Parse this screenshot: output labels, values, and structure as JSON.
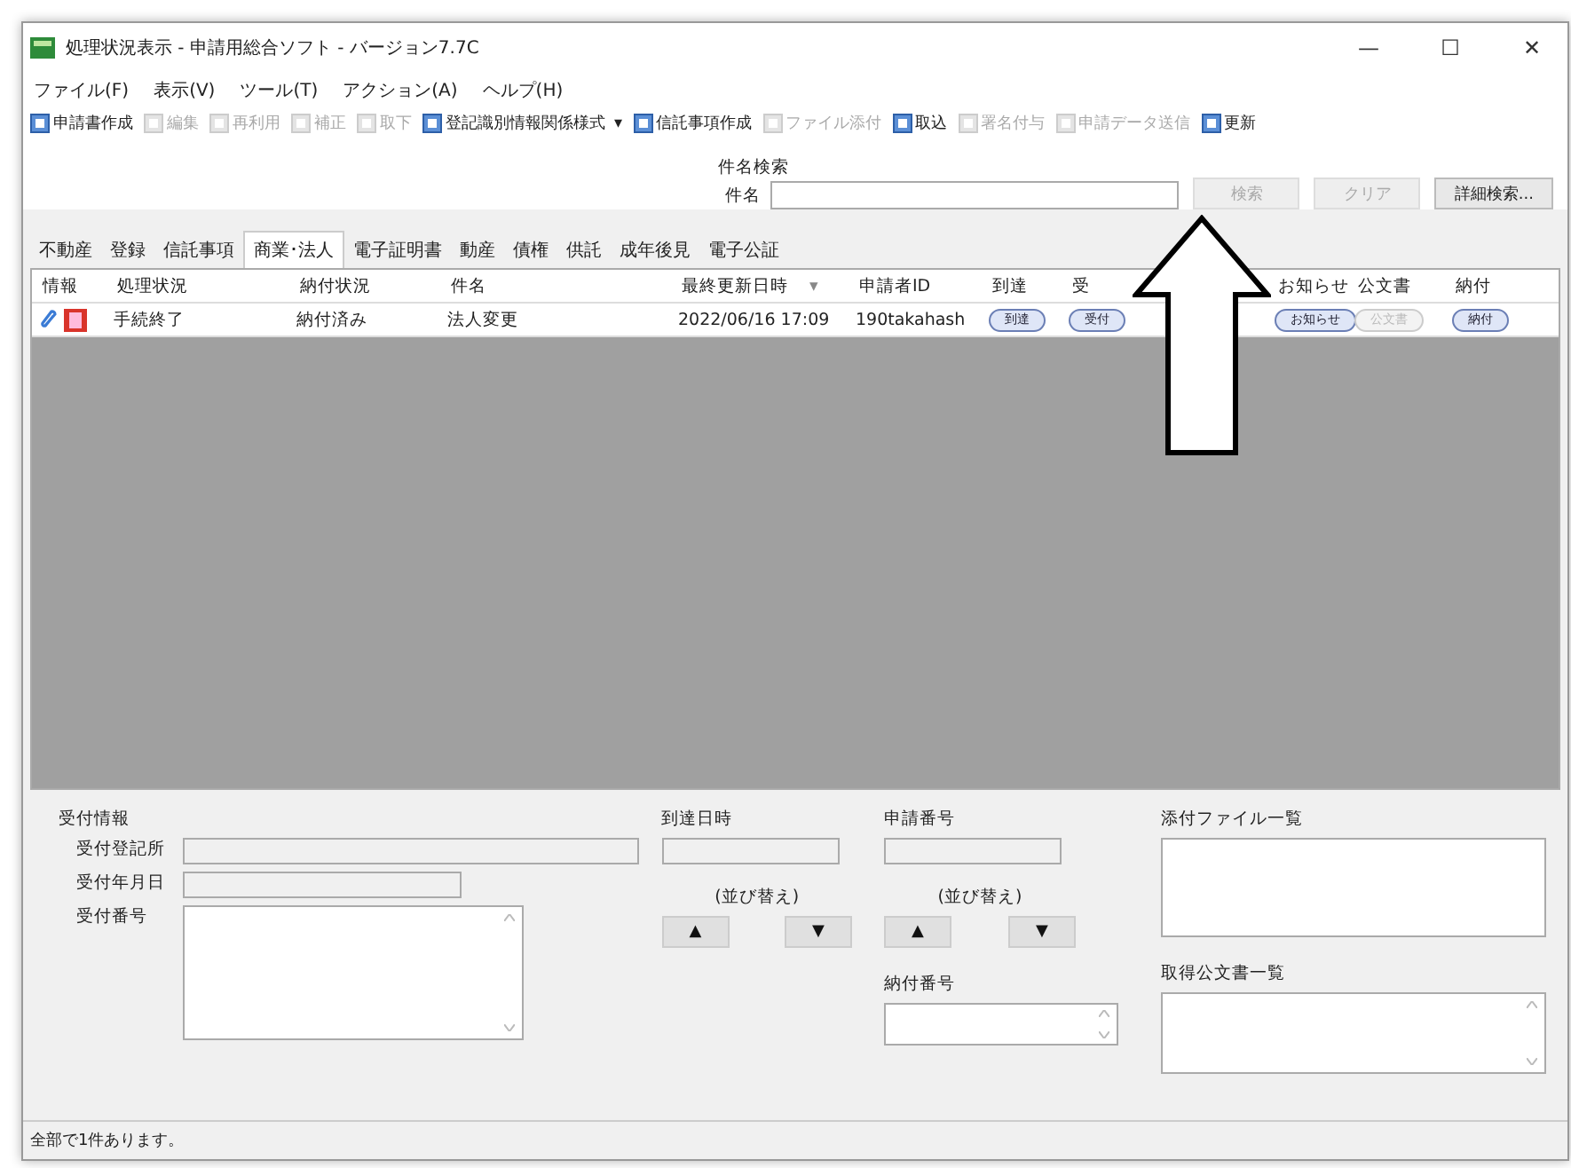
{
  "window": {
    "title": "処理状況表示 - 申請用総合ソフト - バージョン7.7C"
  },
  "menu": [
    "ファイル(F)",
    "表示(V)",
    "ツール(T)",
    "アクション(A)",
    "ヘルプ(H)"
  ],
  "toolbar": [
    {
      "label": "申請書作成",
      "disabled": false
    },
    {
      "label": "編集",
      "disabled": true
    },
    {
      "label": "再利用",
      "disabled": true
    },
    {
      "label": "補正",
      "disabled": true
    },
    {
      "label": "取下",
      "disabled": true
    },
    {
      "label": "登記識別情報関係様式",
      "disabled": false,
      "caret": "▾"
    },
    {
      "label": "信託事項作成",
      "disabled": false
    },
    {
      "label": "ファイル添付",
      "disabled": true
    },
    {
      "label": "取込",
      "disabled": false
    },
    {
      "label": "署名付与",
      "disabled": true
    },
    {
      "label": "申請データ送信",
      "disabled": true
    },
    {
      "label": "更新",
      "disabled": false
    }
  ],
  "search": {
    "group": "件名検索",
    "label": "件名",
    "buttons": [
      {
        "label": "検索",
        "disabled": true
      },
      {
        "label": "クリア",
        "disabled": true
      },
      {
        "label": "詳細検索...",
        "disabled": false
      }
    ]
  },
  "tabs": [
    {
      "label": "不動産",
      "selected": false
    },
    {
      "label": "登録",
      "selected": false
    },
    {
      "label": "信託事項",
      "selected": false
    },
    {
      "label": "商業･法人",
      "selected": true
    },
    {
      "label": "電子証明書",
      "selected": false
    },
    {
      "label": "動産",
      "selected": false
    },
    {
      "label": "債権",
      "selected": false
    },
    {
      "label": "供託",
      "selected": false
    },
    {
      "label": "成年後見",
      "selected": false
    },
    {
      "label": "電子公証",
      "selected": false
    }
  ],
  "table": {
    "columns": [
      {
        "label": "情報"
      },
      {
        "label": "処理状況"
      },
      {
        "label": "納付状況"
      },
      {
        "label": "件名"
      },
      {
        "label": "最終更新日時",
        "sort": "▾"
      },
      {
        "label": "申請者ID"
      },
      {
        "label": "到達"
      },
      {
        "label": "受"
      },
      {
        "label": "お知らせ"
      },
      {
        "label": "公文書"
      },
      {
        "label": "納付"
      }
    ],
    "rows": [
      {
        "cells": [
          {
            "kind": "icons"
          },
          {
            "kind": "text",
            "text": "手続終了"
          },
          {
            "kind": "text",
            "text": "納付済み"
          },
          {
            "kind": "text",
            "text": "法人変更"
          },
          {
            "kind": "text",
            "text": "2022/06/16 17:09"
          },
          {
            "kind": "text",
            "text": "190takahash"
          },
          {
            "kind": "button",
            "text": "到達",
            "disabled": false
          },
          {
            "kind": "button",
            "text": "受付",
            "disabled": false
          },
          {
            "kind": "button",
            "text": "お知らせ",
            "disabled": false
          },
          {
            "kind": "button",
            "text": "公文書",
            "disabled": true
          },
          {
            "kind": "button",
            "text": "納付",
            "disabled": false
          }
        ]
      }
    ]
  },
  "details": {
    "receipt": {
      "title": "受付情報",
      "fields": [
        {
          "label": "受付登記所"
        },
        {
          "label": "受付年月日"
        },
        {
          "label": "受付番号"
        }
      ]
    },
    "sort_groups": [
      {
        "title": "到達日時",
        "sort_label": "(並び替え)",
        "up": "▲",
        "down": "▼"
      },
      {
        "title": "申請番号",
        "sort_label": "(並び替え)",
        "up": "▲",
        "down": "▼"
      }
    ],
    "payment_number": {
      "title": "納付番号"
    },
    "attachments": {
      "title": "添付ファイル一覧"
    },
    "documents": {
      "title": "取得公文書一覧"
    }
  },
  "status_bar": "全部で1件あります。",
  "window_controls": [
    "—",
    "☐",
    "✕"
  ]
}
